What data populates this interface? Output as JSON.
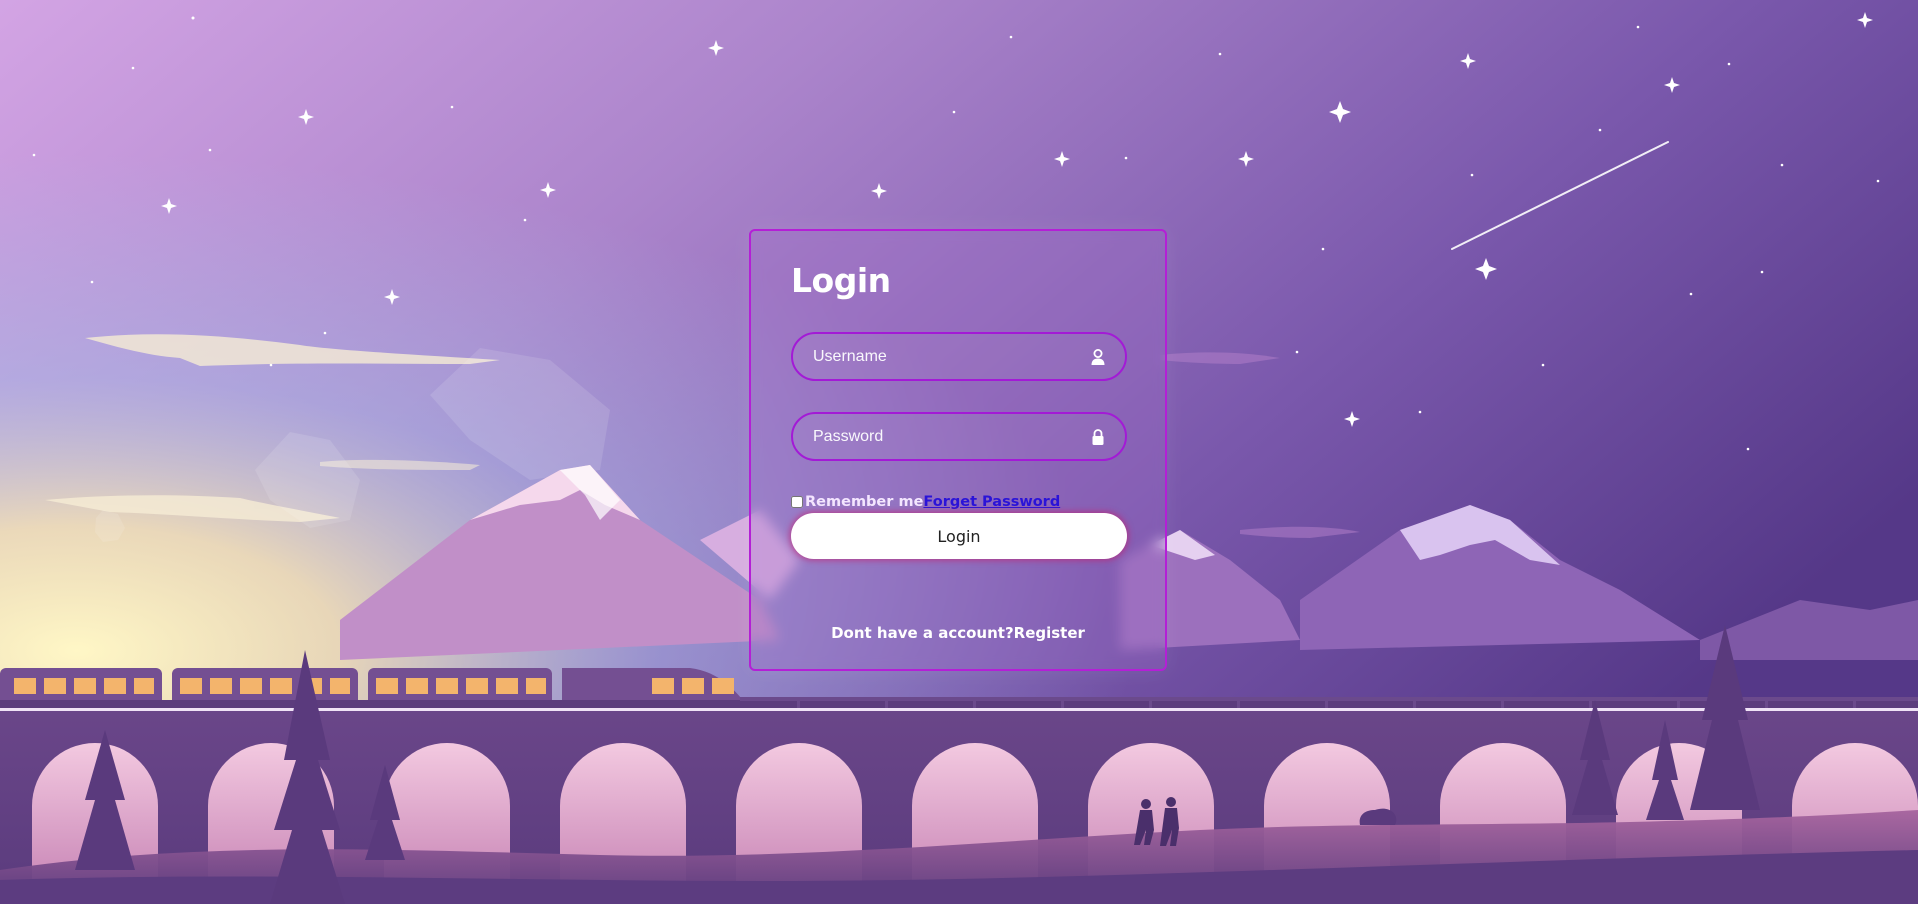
{
  "login": {
    "title": "Login",
    "username_placeholder": "Username",
    "password_placeholder": "Password",
    "remember_label": "Remember me",
    "forget_label": "Forget Password",
    "submit_label": "Login",
    "no_account_text": "Dont have a account?",
    "register_label": "Register"
  },
  "icons": {
    "username": "user-icon",
    "password": "lock-icon"
  },
  "colors": {
    "card_border": "#b41fd6",
    "field_border": "#a31ad6",
    "link": "#2a13d8",
    "button_bg": "#ffffff",
    "button_glow": "#c81e6e"
  }
}
